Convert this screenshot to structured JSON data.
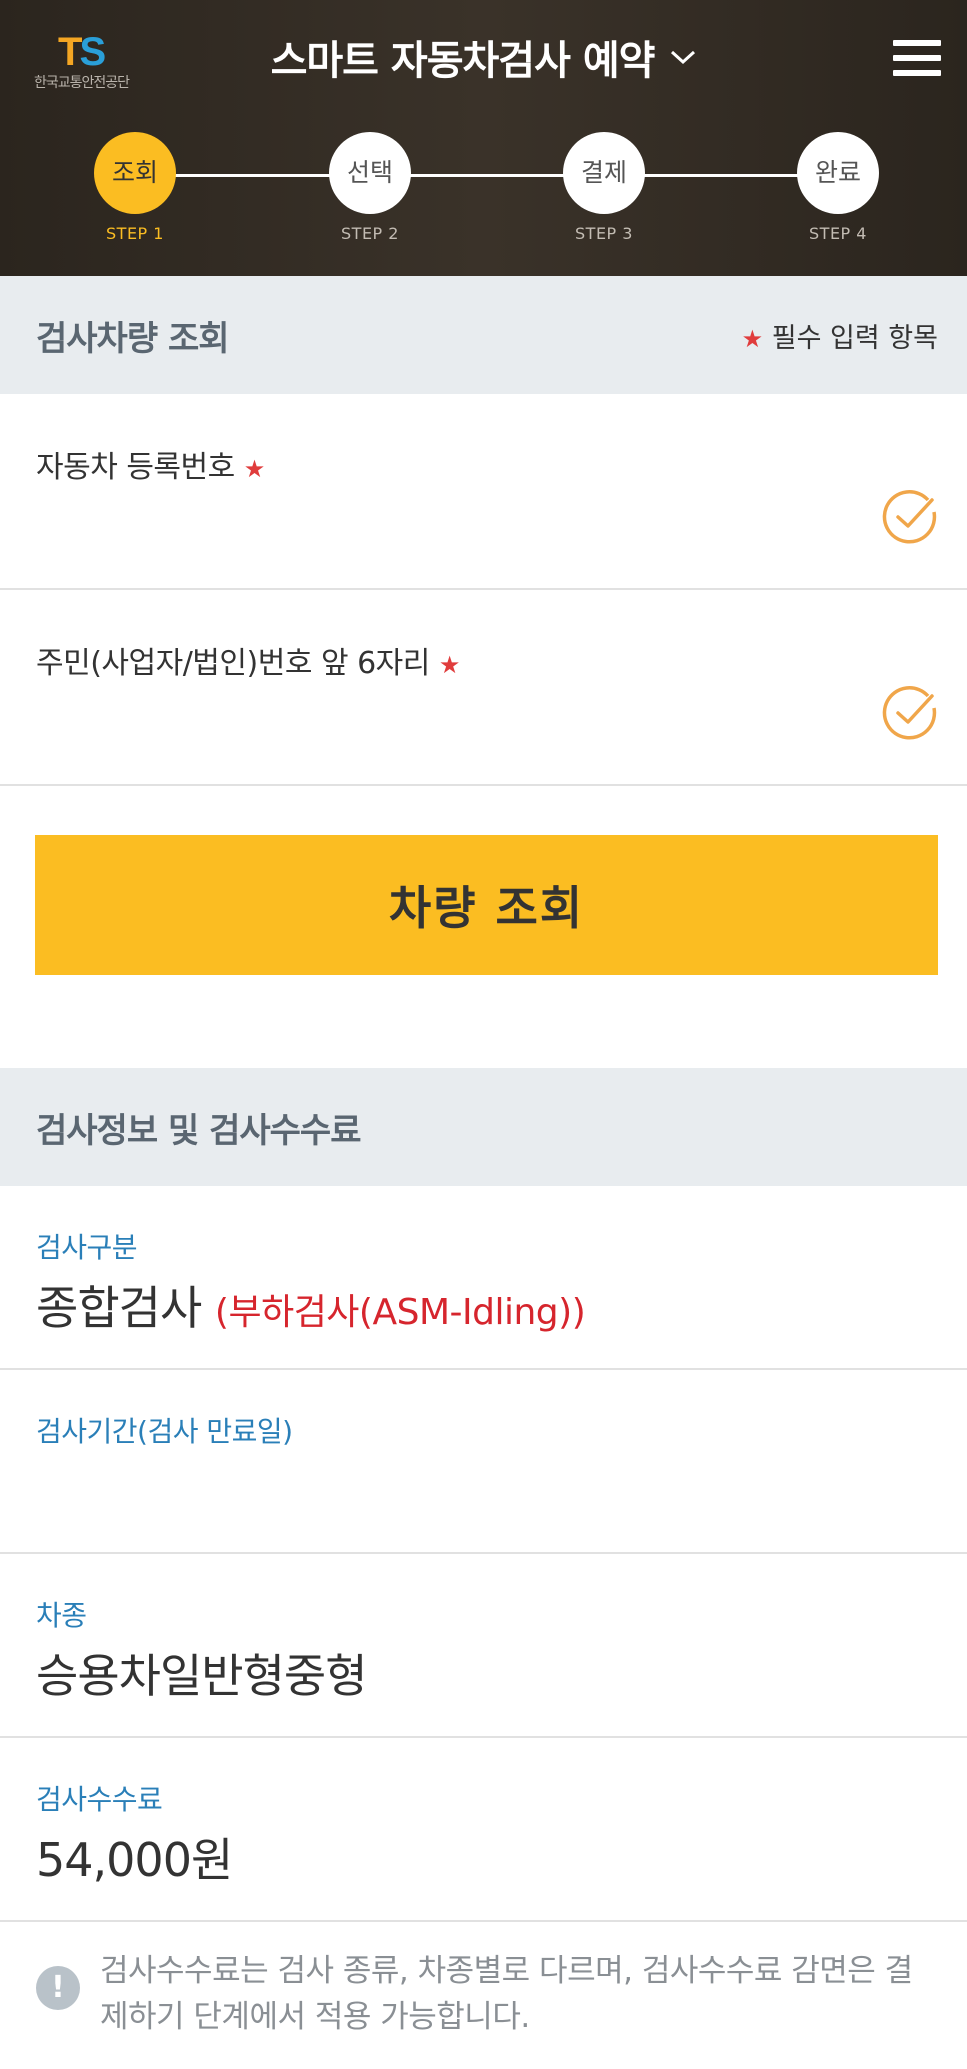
{
  "header": {
    "logo_text_t": "T",
    "logo_text_s": "S",
    "logo_subtitle": "한국교통안전공단",
    "title": "스마트 자동차검사 예약",
    "title_chevron": "chevron-down-icon",
    "menu_icon": "hamburger-menu-icon"
  },
  "steps": [
    {
      "label": "조회",
      "sub": "STEP 1",
      "active": true
    },
    {
      "label": "선택",
      "sub": "STEP 2",
      "active": false
    },
    {
      "label": "결제",
      "sub": "STEP 3",
      "active": false
    },
    {
      "label": "완료",
      "sub": "STEP 4",
      "active": false
    }
  ],
  "lookup_section": {
    "title": "검사차량 조회",
    "required_star": "★",
    "required_note": "필수 입력 항목",
    "fields": [
      {
        "label": "자동차 등록번호",
        "value": ""
      },
      {
        "label": "주민(사업자/법인)번호 앞 6자리",
        "value": ""
      }
    ],
    "button_label": "차량 조회"
  },
  "info_section": {
    "title": "검사정보 및 검사수수료",
    "inspection_type_label": "검사구분",
    "inspection_type_value": "종합검사",
    "inspection_type_sub": "(부하검사(ASM-Idling))",
    "period_label": "검사기간(검사 만료일)",
    "period_value": "",
    "vehicle_type_label": "차종",
    "vehicle_type_value": "승용차일반형중형",
    "fee_label": "검사수수료",
    "fee_value": "54,000원",
    "notice_icon": "!",
    "notice_text": "검사수수료는 검사 종류, 차종별로 다르며, 검사수수료 감면은 결제하기 단계에서 적용 가능합니다."
  },
  "colors": {
    "accent": "#fbbd22",
    "header_bg": "#2f2921",
    "section_bg": "#e8ecef",
    "label_blue": "#2a7fb8",
    "required_red": "#e03c3c",
    "check_orange": "#f0a64a"
  }
}
